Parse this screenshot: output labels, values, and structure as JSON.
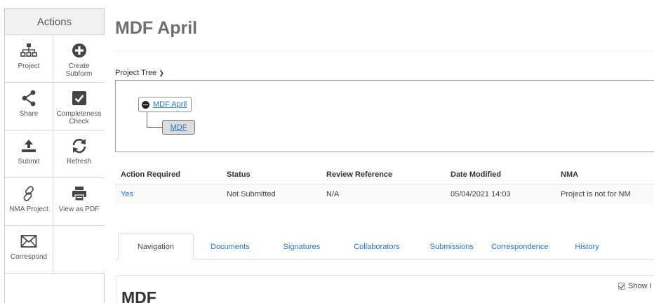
{
  "actions": {
    "header": "Actions",
    "items": [
      {
        "label": "Project",
        "icon": "sitemap-icon"
      },
      {
        "label": "Create\nSubform",
        "icon": "plus-circle-icon"
      },
      {
        "label": "Share",
        "icon": "share-icon"
      },
      {
        "label": "Completeness\nCheck",
        "icon": "checkbox-icon"
      },
      {
        "label": "Submit",
        "icon": "upload-icon"
      },
      {
        "label": "Refresh",
        "icon": "refresh-icon"
      },
      {
        "label": "NMA Project",
        "icon": "link-icon"
      },
      {
        "label": "View as PDF",
        "icon": "printer-icon"
      },
      {
        "label": "Correspond",
        "icon": "envelope-icon"
      }
    ]
  },
  "page": {
    "title": "MDF April",
    "project_tree_label": "Project Tree"
  },
  "tree": {
    "root": "MDF April",
    "child": "MDF"
  },
  "status_table": {
    "headers": [
      "Action Required",
      "Status",
      "Review Reference",
      "Date Modified",
      "NMA"
    ],
    "row": [
      "Yes",
      "Not Submitted",
      "N/A",
      "05/04/2021 14:03",
      "Project is not for NM"
    ]
  },
  "tabs": [
    {
      "label": "Navigation",
      "active": true
    },
    {
      "label": "Documents",
      "active": false
    },
    {
      "label": "Signatures",
      "active": false
    },
    {
      "label": "Collaborators",
      "active": false
    },
    {
      "label": "Submissions",
      "active": false
    },
    {
      "label": "Correspondence",
      "active": false
    },
    {
      "label": "History",
      "active": false
    }
  ],
  "subpanel": {
    "title": "MDF",
    "show_label": "Show I"
  },
  "colors": {
    "link": "#1d76c2",
    "title": "#6f6f6f",
    "icon": "#444444"
  }
}
